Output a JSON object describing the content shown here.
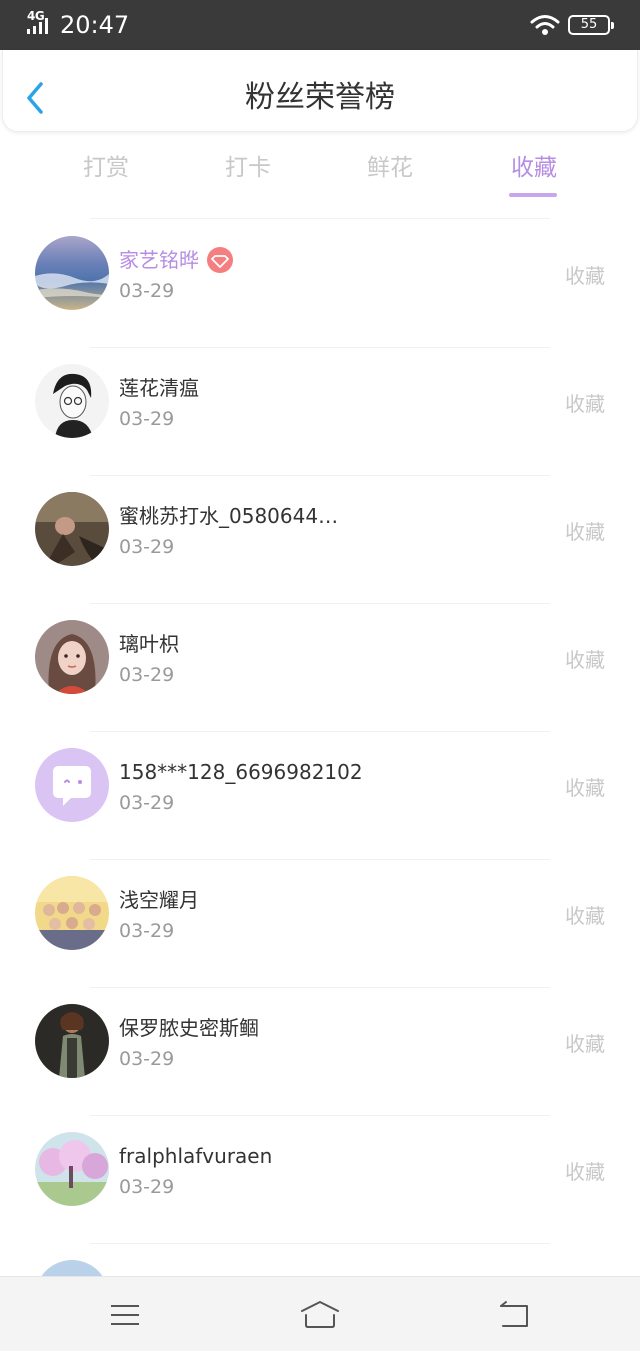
{
  "status_bar": {
    "network": "4G",
    "time": "20:47",
    "battery": "55"
  },
  "header": {
    "title": "粉丝荣誉榜"
  },
  "tabs": [
    {
      "label": "打赏",
      "active": false
    },
    {
      "label": "打卡",
      "active": false
    },
    {
      "label": "鲜花",
      "active": false
    },
    {
      "label": "收藏",
      "active": true
    }
  ],
  "colors": {
    "accent": "#b68ee3",
    "badge": "#f47e80",
    "inactive_text": "#c8c8c8",
    "status_bar_bg": "#3a3a3a"
  },
  "fans": [
    {
      "name": "家艺铭晔",
      "date": "03-29",
      "action": "收藏",
      "highlight": true,
      "badge_icon": "diamond-icon",
      "avatar": "ocean-scene"
    },
    {
      "name": "莲花清瘟",
      "date": "03-29",
      "action": "收藏",
      "avatar": "sketch-portrait"
    },
    {
      "name": "蜜桃苏打水_0580644…",
      "date": "03-29",
      "action": "收藏",
      "avatar": "dim-photo"
    },
    {
      "name": "璃叶枳",
      "date": "03-29",
      "action": "收藏",
      "avatar": "girl-portrait"
    },
    {
      "name": "158***128_6696982102",
      "date": "03-29",
      "action": "收藏",
      "avatar": "chat-bubble-default"
    },
    {
      "name": "浅空耀月",
      "date": "03-29",
      "action": "收藏",
      "avatar": "group-photo"
    },
    {
      "name": "保罗脓史密斯鲴",
      "date": "03-29",
      "action": "收藏",
      "avatar": "dark-figure"
    },
    {
      "name": "fralphlafvuraen",
      "date": "03-29",
      "action": "收藏",
      "avatar": "sakura-scene"
    }
  ],
  "bottom_nav": {
    "icons": [
      "menu-icon",
      "home-icon",
      "back-arrow-icon"
    ]
  }
}
